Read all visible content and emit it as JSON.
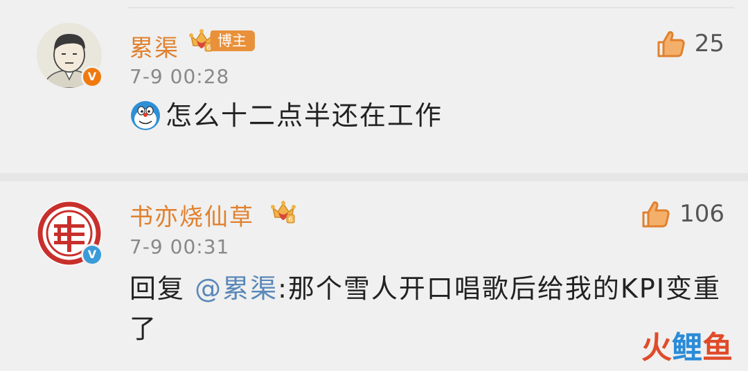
{
  "comments": [
    {
      "username": "累渠",
      "level_tag": "博主",
      "timestamp": "7-9 00:28",
      "likes": "25",
      "emoji": "doraemon-emoji",
      "text": "怎么十二点半还在工作",
      "badge_symbol": "V",
      "badge_color": "#f07a0f"
    },
    {
      "username": "书亦烧仙草",
      "timestamp": "7-9 00:31",
      "likes": "106",
      "reply_prefix": "回复",
      "mention": "@累渠",
      "text": ":那个雪人开口唱歌后给我的KPI变重了",
      "badge_symbol": "V",
      "badge_color": "#3a9bd9"
    }
  ],
  "colors": {
    "username": "#e0812e",
    "timestamp": "#888888",
    "mention": "#5a88b8",
    "background": "#f0f0f0"
  },
  "watermark": {
    "char1": "火",
    "char2": "鲤",
    "char3": "鱼"
  }
}
